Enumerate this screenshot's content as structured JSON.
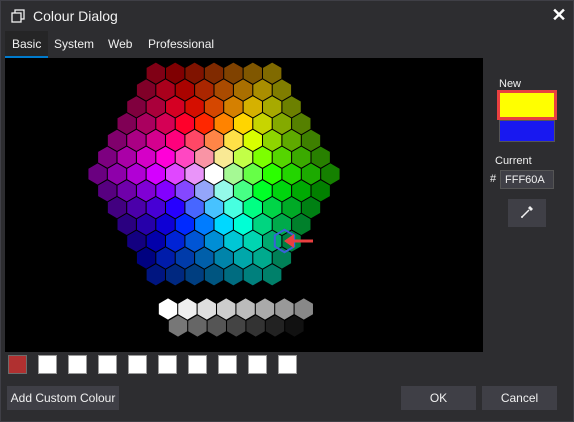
{
  "window": {
    "title": "Colour Dialog",
    "icon": "window-restore-icon"
  },
  "tabs": [
    {
      "label": "Basic",
      "active": true
    },
    {
      "label": "System",
      "active": false
    },
    {
      "label": "Web",
      "active": false
    },
    {
      "label": "Professional",
      "active": false
    }
  ],
  "side": {
    "new_label": "New",
    "current_label": "Current",
    "new_color": "#FFFF00",
    "current_color": "#1818F0",
    "hash": "#",
    "hex_value": "FFF60A",
    "picker_icon": "eyedropper-icon"
  },
  "custom_colours": [
    "#B03030",
    "#FFFFFF",
    "#FFFFFF",
    "#FFFFFF",
    "#FFFFFF",
    "#FFFFFF",
    "#FFFFFF",
    "#FFFFFF",
    "#FFFFFF",
    "#FFFFFF"
  ],
  "buttons": {
    "add_custom": "Add Custom Colour",
    "ok": "OK",
    "cancel": "Cancel"
  },
  "selection_marker": "red-arrow-icon"
}
